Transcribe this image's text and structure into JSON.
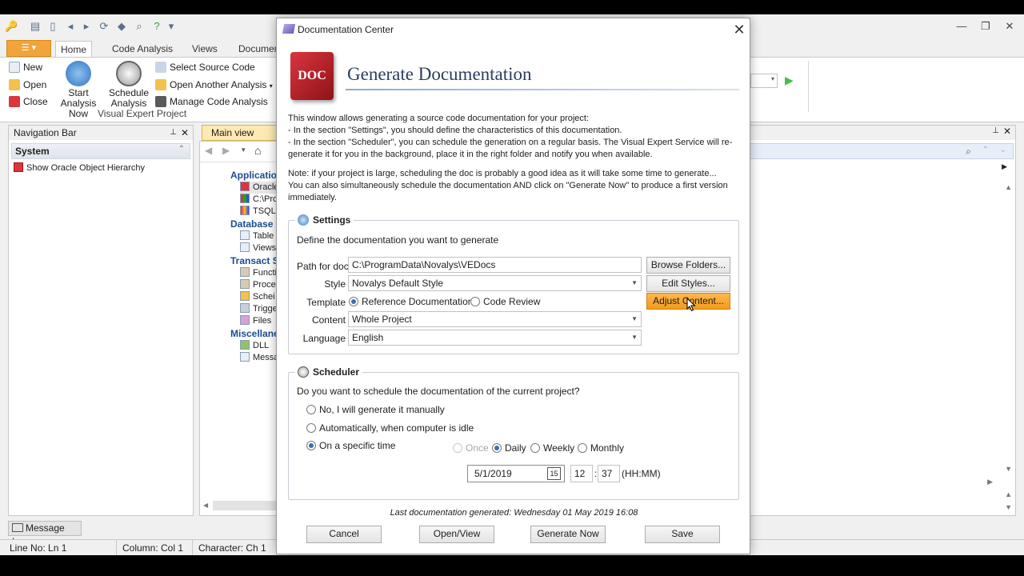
{
  "ribbon": {
    "file_label": "☰ ▾",
    "tabs": [
      "Home",
      "Code Analysis",
      "Views",
      "Documen"
    ],
    "new": "New",
    "open": "Open",
    "close": "Close",
    "start_analysis": "Start Analysis Now",
    "schedule_analysis": "Schedule Analysis",
    "select_source": "Select Source Code",
    "open_another": "Open Another Analysis",
    "manage_analysis": "Manage Code Analysis",
    "group_label": "Visual Expert Project"
  },
  "nav": {
    "title": "Navigation Bar",
    "section": "System",
    "items": [
      "Show Oracle Object Hierarchy"
    ]
  },
  "main_view": {
    "tab": "Main view",
    "tree": [
      {
        "head": "Applicatio"
      },
      {
        "item": "Oracle",
        "selected": true
      },
      {
        "item": "C:\\Pro"
      },
      {
        "item": "TSQL"
      },
      {
        "head": "Database"
      },
      {
        "item": "Table"
      },
      {
        "item": "Views"
      },
      {
        "head": "Transact S"
      },
      {
        "item": "Functi"
      },
      {
        "item": "Proce"
      },
      {
        "item": "Schei"
      },
      {
        "item": "Trigge"
      },
      {
        "item": "Files"
      },
      {
        "head": "Miscellane"
      },
      {
        "item": "DLL"
      },
      {
        "item": "Messa"
      }
    ]
  },
  "message_log": "Message Log",
  "status": {
    "line": "Line No: Ln 1",
    "column": "Column: Col 1",
    "character": "Character: Ch 1"
  },
  "dialog": {
    "window_title": "Documentation Center",
    "logo_text": "DOC",
    "heading": "Generate Documentation",
    "intro": [
      "This window allows generating a source code documentation for your project:",
      "- In the section \"Settings\", you should define the characteristics of this documentation.",
      "- In the section \"Scheduler\", you can schedule the generation on a regular basis. The Visual Expert Service will re-",
      "generate it for you in the background, place it in the right folder and notify you when available."
    ],
    "note": [
      "Note: if your project is large, scheduling the doc is probably a good idea as it will take some time to generate...",
      "You can also simultaneously schedule the documentation AND click on \"Generate Now\" to produce a first version",
      "immediately."
    ],
    "settings": {
      "title": "Settings",
      "description": "Define the documentation you want to generate",
      "path_label": "Path for doc",
      "path_value": "C:\\ProgramData\\Novalys\\VEDocs",
      "style_label": "Style",
      "style_value": "Novalys Default Style",
      "template_label": "Template",
      "template_options": [
        "Reference Documentation",
        "Code Review"
      ],
      "template_selected": "Reference Documentation",
      "content_label": "Content",
      "content_value": "Whole Project",
      "language_label": "Language",
      "language_value": "English",
      "browse_button": "Browse Folders...",
      "edit_styles_button": "Edit Styles...",
      "adjust_content_button": "Adjust Content..."
    },
    "scheduler": {
      "title": "Scheduler",
      "question": "Do you want to schedule the documentation of the current project?",
      "options": [
        "No, I will generate it manually",
        "Automatically, when computer is idle",
        "On a specific time"
      ],
      "selected": "On a specific time",
      "frequency": [
        "Once",
        "Daily",
        "Weekly",
        "Monthly"
      ],
      "frequency_selected": "Daily",
      "date": "5/1/2019",
      "calendar_icon_label": "15",
      "hour": "12",
      "time_sep": ":",
      "minute": "37",
      "time_format": "(HH:MM)"
    },
    "last_generated": "Last documentation generated: Wednesday 01 May 2019 16:08",
    "buttons": {
      "cancel": "Cancel",
      "open_view": "Open/View",
      "generate_now": "Generate Now",
      "save": "Save"
    }
  },
  "colors": {
    "accent_orange": "#f39a1c",
    "doc_red": "#c8252c",
    "heading_blue": "#2a3f5c",
    "selected_radio": "#3a6fb5"
  }
}
